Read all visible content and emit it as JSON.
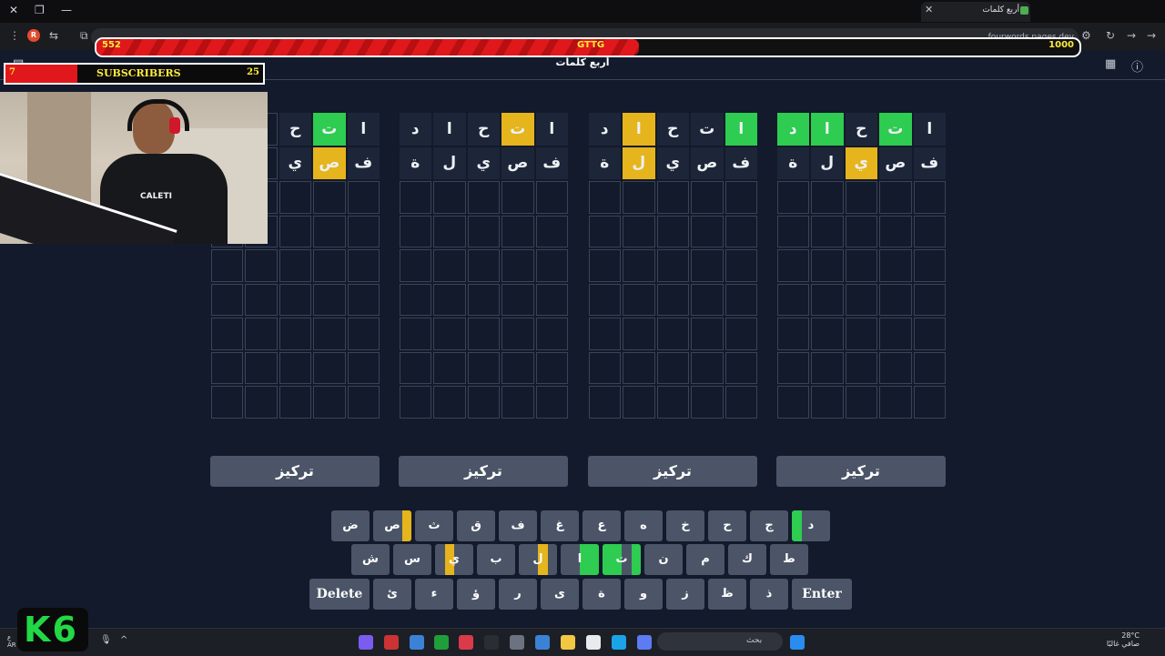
{
  "browser": {
    "tab_title": "أربع كلمات",
    "url": "fourwords.pages.dev"
  },
  "overlay": {
    "progress": {
      "current": "552",
      "label": "GTTG",
      "max": "1000",
      "fraction": 0.552
    },
    "subscribers": {
      "count": "7",
      "label": "SUBSCRIBERS",
      "goal": "25",
      "fraction": 0.28
    }
  },
  "page": {
    "title": "أربع كلمات"
  },
  "webcam": {
    "shirt_text": "CALETI"
  },
  "boards": [
    {
      "rows": [
        [
          {
            "l": "ا",
            "s": "f"
          },
          {
            "l": "ت",
            "s": "g"
          },
          {
            "l": "ح",
            "s": "f"
          },
          {
            "l": "ا",
            "s": "g"
          },
          {
            "l": "د",
            "s": "g"
          }
        ],
        [
          {
            "l": "ف",
            "s": "f"
          },
          {
            "l": "ص",
            "s": "f"
          },
          {
            "l": "ي",
            "s": "y"
          },
          {
            "l": "ل",
            "s": "f"
          },
          {
            "l": "ة",
            "s": "f"
          }
        ]
      ],
      "focus_label": "تركيز"
    },
    {
      "rows": [
        [
          {
            "l": "ا",
            "s": "g"
          },
          {
            "l": "ت",
            "s": "f"
          },
          {
            "l": "ح",
            "s": "f"
          },
          {
            "l": "ا",
            "s": "y"
          },
          {
            "l": "د",
            "s": "f"
          }
        ],
        [
          {
            "l": "ف",
            "s": "f"
          },
          {
            "l": "ص",
            "s": "f"
          },
          {
            "l": "ي",
            "s": "f"
          },
          {
            "l": "ل",
            "s": "y"
          },
          {
            "l": "ة",
            "s": "f"
          }
        ]
      ],
      "focus_label": "تركيز"
    },
    {
      "rows": [
        [
          {
            "l": "ا",
            "s": "f"
          },
          {
            "l": "ت",
            "s": "y"
          },
          {
            "l": "ح",
            "s": "f"
          },
          {
            "l": "ا",
            "s": "f"
          },
          {
            "l": "د",
            "s": "f"
          }
        ],
        [
          {
            "l": "ف",
            "s": "f"
          },
          {
            "l": "ص",
            "s": "f"
          },
          {
            "l": "ي",
            "s": "f"
          },
          {
            "l": "ل",
            "s": "f"
          },
          {
            "l": "ة",
            "s": "f"
          }
        ]
      ],
      "focus_label": "تركيز"
    },
    {
      "rows": [
        [
          {
            "l": "ا",
            "s": "f"
          },
          {
            "l": "ت",
            "s": "g"
          },
          {
            "l": "ح",
            "s": "f"
          },
          {
            "l": "",
            "s": "e"
          },
          {
            "l": "",
            "s": "e"
          }
        ],
        [
          {
            "l": "ف",
            "s": "f"
          },
          {
            "l": "ص",
            "s": "y"
          },
          {
            "l": "ي",
            "s": "f"
          },
          {
            "l": "",
            "s": "e"
          },
          {
            "l": "",
            "s": "e"
          }
        ]
      ],
      "focus_label": "تركيز"
    }
  ],
  "keyboard": {
    "rows": [
      [
        {
          "l": "د",
          "c": [
            "e",
            "e",
            "e",
            "g"
          ]
        },
        {
          "l": "ج",
          "c": []
        },
        {
          "l": "ح",
          "c": []
        },
        {
          "l": "خ",
          "c": []
        },
        {
          "l": "ه",
          "c": []
        },
        {
          "l": "ع",
          "c": []
        },
        {
          "l": "غ",
          "c": []
        },
        {
          "l": "ف",
          "c": []
        },
        {
          "l": "ق",
          "c": []
        },
        {
          "l": "ث",
          "c": []
        },
        {
          "l": "ص",
          "c": [
            "y",
            "e",
            "e",
            "e"
          ]
        },
        {
          "l": "ض",
          "c": []
        }
      ],
      [
        {
          "l": "ط",
          "c": []
        },
        {
          "l": "ك",
          "c": []
        },
        {
          "l": "م",
          "c": []
        },
        {
          "l": "ن",
          "c": []
        },
        {
          "l": "ت",
          "c": [
            "g",
            "e",
            "g",
            "g"
          ]
        },
        {
          "l": "ا",
          "c": [
            "g",
            "g",
            "e",
            "e"
          ]
        },
        {
          "l": "ل",
          "c": [
            "e",
            "y",
            "e",
            "e"
          ]
        },
        {
          "l": "ب",
          "c": []
        },
        {
          "l": "ي",
          "c": [
            "e",
            "e",
            "y",
            "e"
          ]
        },
        {
          "l": "س",
          "c": []
        },
        {
          "l": "ش",
          "c": []
        }
      ],
      [
        {
          "l": "Enter",
          "c": [],
          "wide": true
        },
        {
          "l": "ذ",
          "c": []
        },
        {
          "l": "ظ",
          "c": []
        },
        {
          "l": "ز",
          "c": []
        },
        {
          "l": "و",
          "c": []
        },
        {
          "l": "ة",
          "c": []
        },
        {
          "l": "ى",
          "c": []
        },
        {
          "l": "ر",
          "c": []
        },
        {
          "l": "ؤ",
          "c": []
        },
        {
          "l": "ء",
          "c": []
        },
        {
          "l": "ئ",
          "c": []
        },
        {
          "l": "Delete",
          "c": [],
          "wide": true
        }
      ]
    ]
  },
  "taskbar": {
    "search_placeholder": "بحث",
    "weather_temp": "28°C",
    "weather_desc": "صافي غالبًا",
    "lang_1": "ع",
    "lang_2": "AR",
    "logo_text": "K6"
  },
  "colors": {
    "correct": "#2ecc50",
    "present": "#e6b41c",
    "absent": "#1d2638",
    "key": "#4b5567",
    "background": "#121a2b"
  }
}
